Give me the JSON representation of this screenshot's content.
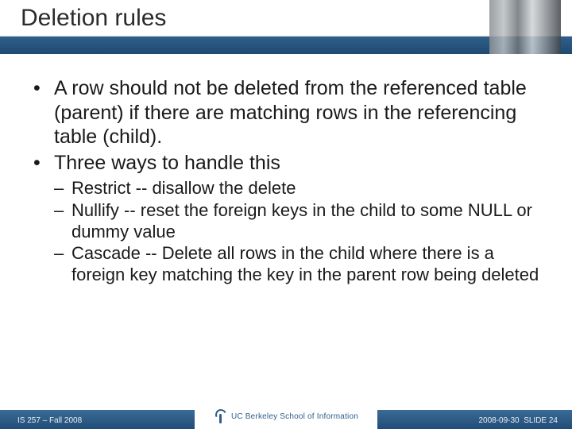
{
  "header": {
    "title": "Deletion rules"
  },
  "bullets": [
    "A row should not be deleted from the referenced table (parent) if there are matching rows in the referencing table (child).",
    "Three ways to handle this"
  ],
  "subbullets": [
    "Restrict -- disallow the delete",
    "Nullify -- reset the foreign keys in the child to some NULL or dummy value",
    "Cascade -- Delete all rows in the child where there is a foreign key matching the key in the parent row being deleted"
  ],
  "footer": {
    "left": "IS 257 – Fall 2008",
    "logo_text": "UC Berkeley School of Information",
    "right_date": "2008-09-30",
    "right_slide": "SLIDE 24"
  }
}
